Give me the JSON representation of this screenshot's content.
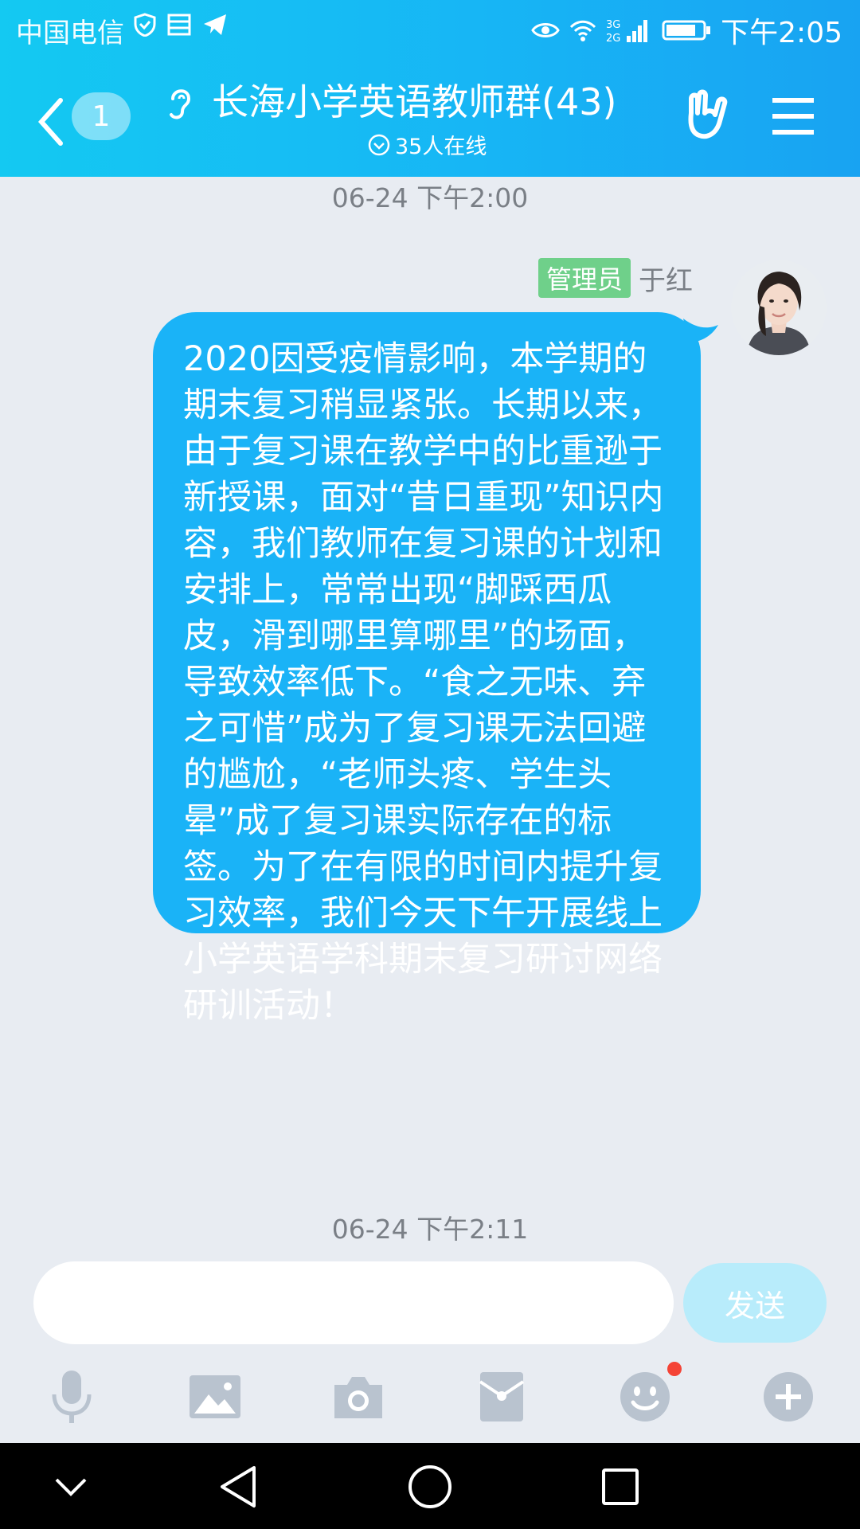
{
  "status_bar": {
    "carrier": "中国电信",
    "network": "3G 2G",
    "time": "下午2:05"
  },
  "header": {
    "unread_count": "1",
    "group_title": "长海小学英语教师群(43)",
    "online_text": "35人在线"
  },
  "chat": {
    "timestamp_1": "06-24 下午2:00",
    "message": {
      "badge": "管理员",
      "sender": "于红",
      "text": "  2020因受疫情影响，本学期的期末复习稍显紧张。长期以来，由于复习课在教学中的比重逊于新授课，面对“昔日重现”知识内容，我们教师在复习课的计划和安排上，常常出现“脚踩西瓜皮，滑到哪里算哪里”的场面，导致效率低下。“食之无味、弃之可惜”成为了复习课无法回避的尴尬，“老师头疼、学生头晕”成了复习课实际存在的标签。为了在有限的时间内提升复习效率，我们今天下午开展线上小学英语学科期末复习研讨网络研训活动！"
    },
    "timestamp_2": "06-24 下午2:11"
  },
  "composer": {
    "placeholder": "",
    "send_label": "发送"
  },
  "colors": {
    "header_start": "#14c9f2",
    "header_end": "#18a3f2",
    "bubble": "#1ab3f7",
    "admin_badge": "#6fd08a",
    "send_disabled": "#b8ecfb"
  },
  "icons": {
    "toolbar": [
      "microphone-icon",
      "image-icon",
      "camera-icon",
      "red-packet-icon",
      "emoji-icon",
      "plus-icon"
    ],
    "system_nav": [
      "collapse-icon",
      "back-triangle-icon",
      "home-circle-icon",
      "recents-square-icon"
    ]
  }
}
